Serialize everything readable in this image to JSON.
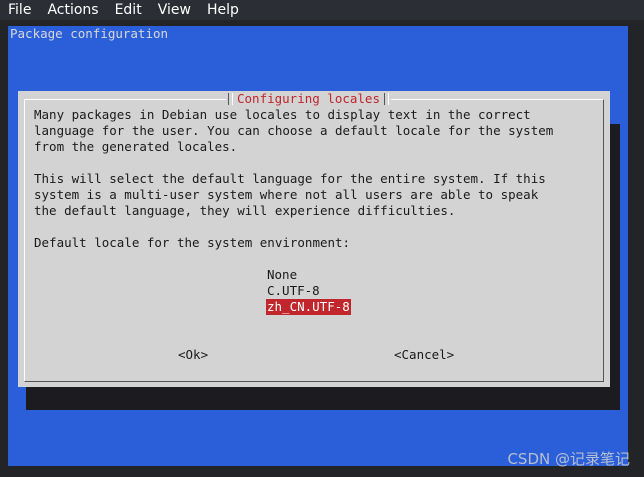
{
  "menubar": {
    "items": [
      "File",
      "Actions",
      "Edit",
      "View",
      "Help"
    ]
  },
  "terminal": {
    "header": "Package configuration"
  },
  "dialog": {
    "title": "Configuring locales",
    "paragraph1": [
      "Many packages in Debian use locales to display text in the correct",
      "language for the user. You can choose a default locale for the system",
      "from the generated locales."
    ],
    "paragraph2": [
      "This will select the default language for the entire system. If this",
      "system is a multi-user system where not all users are able to speak",
      "the default language, they will experience difficulties."
    ],
    "prompt": "Default locale for the system environment:",
    "options": [
      "None",
      "C.UTF-8",
      "zh_CN.UTF-8"
    ],
    "selected_index": 2,
    "ok_label": "<Ok>",
    "cancel_label": "<Cancel>"
  },
  "watermark": "CSDN @记录笔记",
  "colors": {
    "blue_background": "#2b5fd9",
    "dialog_background": "#d3d3d3",
    "accent_red": "#c0262b"
  }
}
